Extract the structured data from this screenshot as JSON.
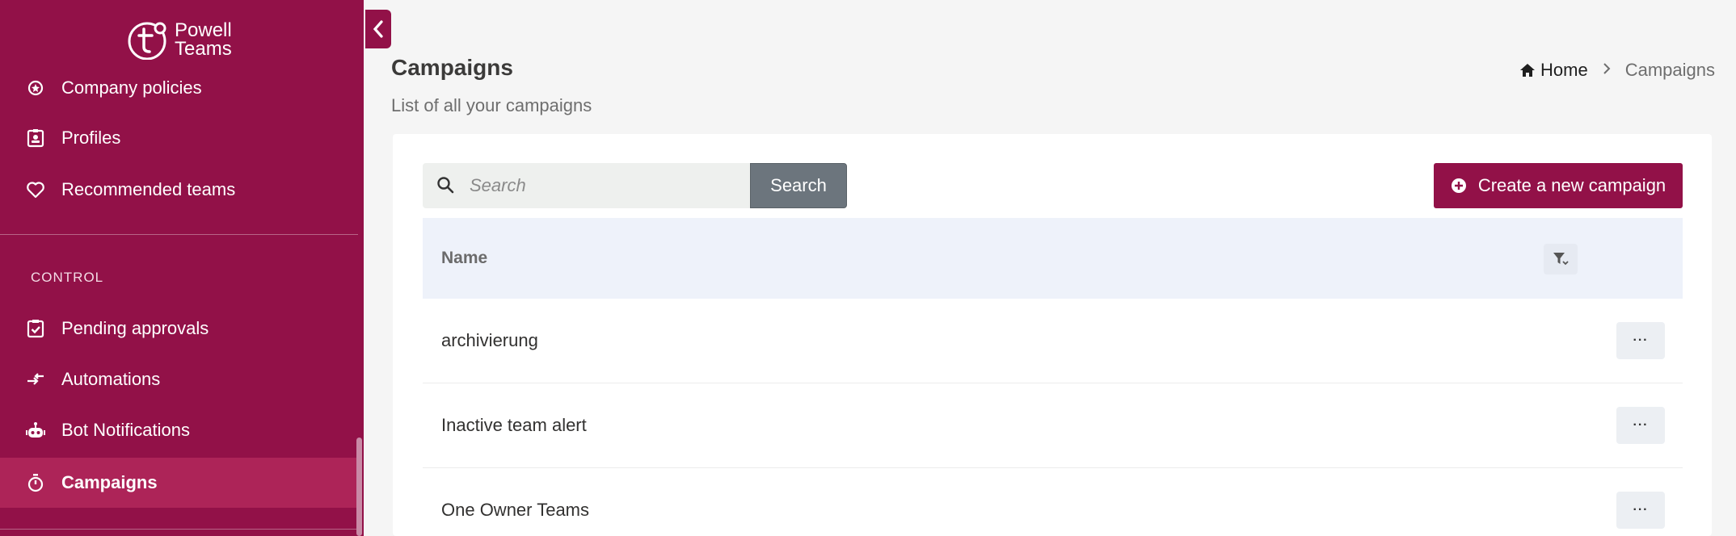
{
  "app": {
    "logo_line1": "Powell",
    "logo_line2": "Teams"
  },
  "sidebar": {
    "items_top": [
      {
        "label": "Company policies",
        "icon": "badge-star-icon"
      },
      {
        "label": "Profiles",
        "icon": "contact-card-icon"
      },
      {
        "label": "Recommended teams",
        "icon": "heart-icon"
      }
    ],
    "section_label": "CONTROL",
    "items_control": [
      {
        "label": "Pending approvals",
        "icon": "clipboard-check-icon"
      },
      {
        "label": "Automations",
        "icon": "arrows-exchange-icon"
      },
      {
        "label": "Bot Notifications",
        "icon": "robot-icon"
      },
      {
        "label": "Campaigns",
        "icon": "stopwatch-icon",
        "active": true
      }
    ]
  },
  "header": {
    "title": "Campaigns",
    "subtitle": "List of all your campaigns",
    "breadcrumb_home": "Home",
    "breadcrumb_current": "Campaigns"
  },
  "toolbar": {
    "search_placeholder": "Search",
    "search_button": "Search",
    "create_button": "Create a new campaign"
  },
  "table": {
    "column_name": "Name",
    "rows": [
      "archivierung",
      "Inactive team alert",
      "One Owner Teams"
    ],
    "row_action": "···"
  },
  "colors": {
    "brand": "#921148",
    "active_item": "#ad2458"
  }
}
